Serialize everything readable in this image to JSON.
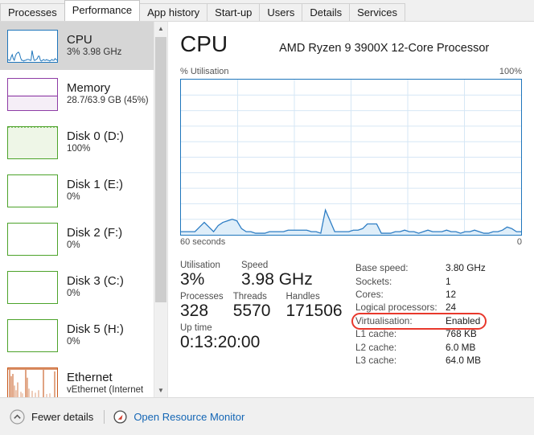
{
  "window": {
    "app": "Task Manager"
  },
  "tabs": [
    {
      "label": "Processes",
      "active": false
    },
    {
      "label": "Performance",
      "active": true
    },
    {
      "label": "App history",
      "active": false
    },
    {
      "label": "Start-up",
      "active": false
    },
    {
      "label": "Users",
      "active": false
    },
    {
      "label": "Details",
      "active": false
    },
    {
      "label": "Services",
      "active": false
    }
  ],
  "sidebar": {
    "items": [
      {
        "name": "CPU",
        "sub": "3%  3.98 GHz",
        "sub2": "",
        "selected": true,
        "color": "#1f76bc",
        "kind": "line",
        "fill": 0
      },
      {
        "name": "Memory",
        "sub": "28.7/63.9 GB (45%)",
        "sub2": "",
        "selected": false,
        "color": "#8e3ca5",
        "kind": "area",
        "fill": 45
      },
      {
        "name": "Disk 0 (D:)",
        "sub": "100%",
        "sub2": "",
        "selected": false,
        "color": "#4ca32a",
        "kind": "area",
        "fill": 100
      },
      {
        "name": "Disk 1 (E:)",
        "sub": "0%",
        "sub2": "",
        "selected": false,
        "color": "#4ca32a",
        "kind": "area",
        "fill": 0
      },
      {
        "name": "Disk 2 (F:)",
        "sub": "0%",
        "sub2": "",
        "selected": false,
        "color": "#4ca32a",
        "kind": "area",
        "fill": 0
      },
      {
        "name": "Disk 3 (C:)",
        "sub": "0%",
        "sub2": "",
        "selected": false,
        "color": "#4ca32a",
        "kind": "area",
        "fill": 0
      },
      {
        "name": "Disk 5 (H:)",
        "sub": "0%",
        "sub2": "",
        "selected": false,
        "color": "#4ca32a",
        "kind": "area",
        "fill": 0
      },
      {
        "name": "Ethernet",
        "sub": "vEthernet (Internet",
        "sub2": "",
        "selected": false,
        "color": "#c85a1e",
        "kind": "spikes",
        "fill": 0
      }
    ],
    "scrollbar": {
      "up_icon": "chevron-up-icon",
      "down_icon": "chevron-down-icon"
    }
  },
  "main": {
    "title": "CPU",
    "subtitle": "AMD Ryzen 9 3900X 12-Core Processor",
    "axis_label": "% Utilisation",
    "axis_max": "100%",
    "time_start": "60 seconds",
    "time_end": "0",
    "stats": {
      "row1": [
        {
          "label": "Utilisation",
          "value": "3%"
        },
        {
          "label": "Speed",
          "value": "3.98 GHz"
        }
      ],
      "row2": [
        {
          "label": "Processes",
          "value": "328"
        },
        {
          "label": "Threads",
          "value": "5570"
        },
        {
          "label": "Handles",
          "value": "171506"
        }
      ],
      "row3": [
        {
          "label": "Up time",
          "value": "0:13:20:00"
        }
      ]
    },
    "details": [
      {
        "key": "Base speed:",
        "value": "3.80 GHz",
        "highlighted": false
      },
      {
        "key": "Sockets:",
        "value": "1",
        "highlighted": false
      },
      {
        "key": "Cores:",
        "value": "12",
        "highlighted": false
      },
      {
        "key": "Logical processors:",
        "value": "24",
        "highlighted": false
      },
      {
        "key": "Virtualisation:",
        "value": "Enabled",
        "highlighted": true
      },
      {
        "key": "L1 cache:",
        "value": "768 KB",
        "highlighted": false
      },
      {
        "key": "L2 cache:",
        "value": "6.0 MB",
        "highlighted": false
      },
      {
        "key": "L3 cache:",
        "value": "64.0 MB",
        "highlighted": false
      }
    ],
    "highlight_color": "#e8382c"
  },
  "chart_data": {
    "type": "area",
    "title": "CPU % Utilisation over 60 seconds",
    "xlabel": "60 seconds",
    "ylabel": "% Utilisation",
    "ylim": [
      0,
      100
    ],
    "xlim": [
      60,
      0
    ],
    "grid": true,
    "line_color": "#2d7dc4",
    "fill_color": "#dfeef9",
    "series": [
      {
        "name": "CPU utilisation",
        "values": [
          2,
          2,
          2,
          2,
          5,
          8,
          5,
          2,
          6,
          8,
          9,
          10,
          9,
          4,
          2,
          2,
          1,
          1,
          1,
          2,
          2,
          2,
          2,
          3,
          3,
          3,
          3,
          3,
          2,
          2,
          1,
          16,
          9,
          2,
          2,
          2,
          2,
          3,
          3,
          4,
          7,
          7,
          7,
          1,
          1,
          1,
          2,
          2,
          3,
          2,
          2,
          1,
          2,
          3,
          2,
          2,
          2,
          3,
          2,
          2,
          1,
          2,
          2,
          3,
          2,
          1,
          1,
          2,
          2,
          3,
          5,
          4,
          2,
          2
        ]
      }
    ]
  },
  "footer": {
    "fewer_details_label": "Fewer details",
    "fewer_details_icon": "chevron-up-circle-icon",
    "resource_monitor_label": "Open Resource Monitor",
    "resource_monitor_icon": "resource-monitor-icon"
  }
}
